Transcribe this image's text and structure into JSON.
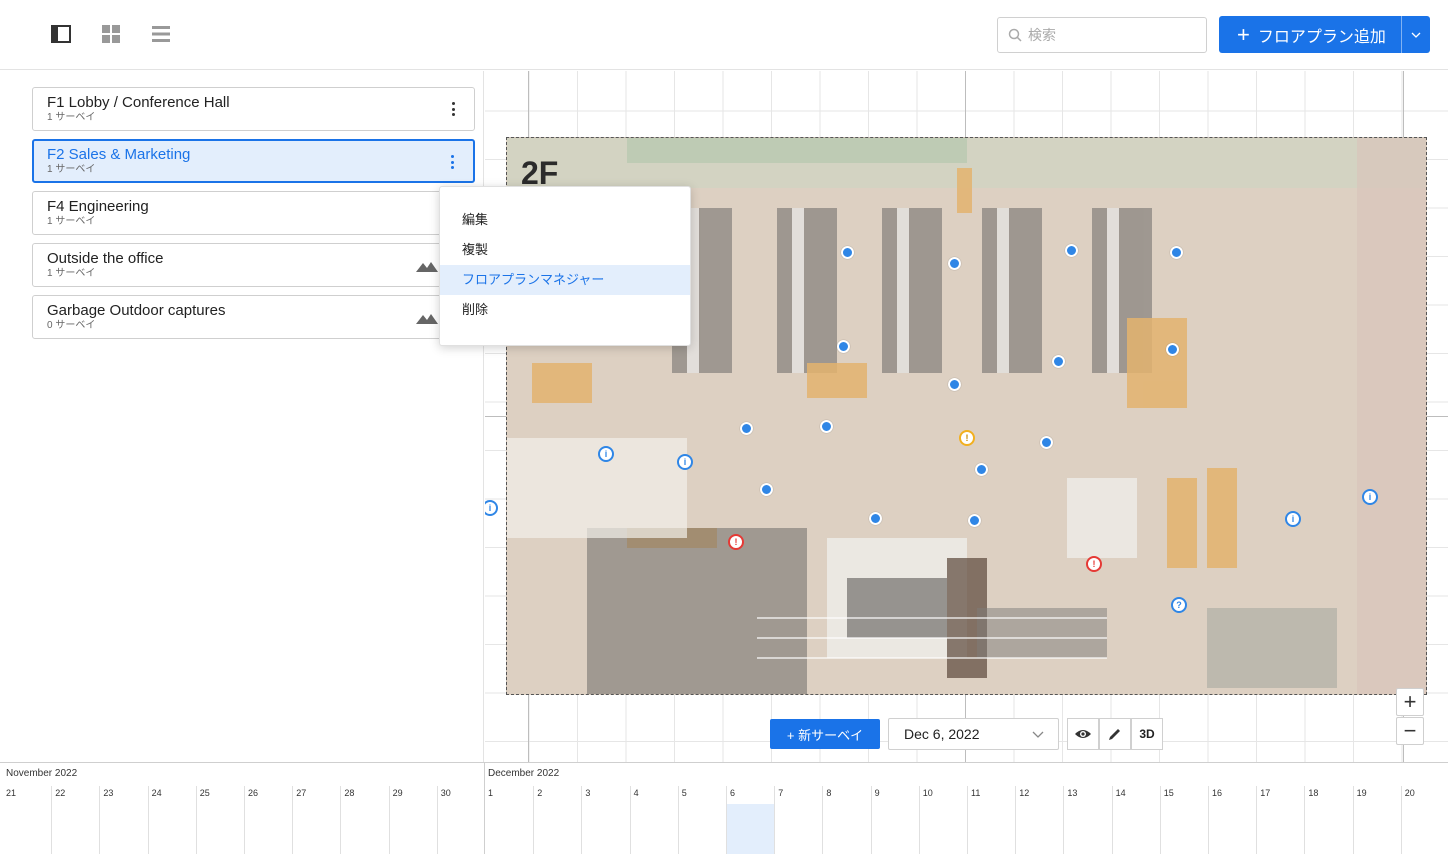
{
  "toolbar": {
    "search_placeholder": "検索",
    "add_button_label": "フロアプラン追加"
  },
  "floorplans": [
    {
      "name": "F1 Lobby / Conference Hall",
      "surveys": "1 サーベイ"
    },
    {
      "name": "F2 Sales & Marketing",
      "surveys": "1 サーベイ"
    },
    {
      "name": "F4 Engineering",
      "surveys": "1 サーベイ"
    },
    {
      "name": "Outside the office",
      "surveys": "1 サーベイ"
    },
    {
      "name": "Garbage Outdoor captures",
      "surveys": "0 サーベイ"
    }
  ],
  "context_menu": {
    "items": [
      "編集",
      "複製",
      "フロアプランマネジャー",
      "削除"
    ]
  },
  "canvas": {
    "plan_label": "2F",
    "new_survey_label": "+ 新サーベイ",
    "date_value": "Dec 6, 2022",
    "mode_3d_label": "3D",
    "zoom_in": "+",
    "zoom_out": "−"
  },
  "timeline": {
    "months": [
      "November 2022",
      "December 2022"
    ],
    "november_days": [
      "21",
      "22",
      "23",
      "24",
      "25",
      "26",
      "27",
      "28",
      "29",
      "30"
    ],
    "december_days": [
      "1",
      "2",
      "3",
      "4",
      "5",
      "6",
      "7",
      "8",
      "9",
      "10",
      "11",
      "12",
      "13",
      "14",
      "15",
      "16",
      "17",
      "18",
      "19",
      "20"
    ],
    "selected_day": "6"
  },
  "colors": {
    "accent": "#1a73e8",
    "selected_bg": "#e3eefc",
    "marker_blue": "#2f86e6",
    "marker_red": "#e53935",
    "marker_yellow": "#f2b01e"
  }
}
